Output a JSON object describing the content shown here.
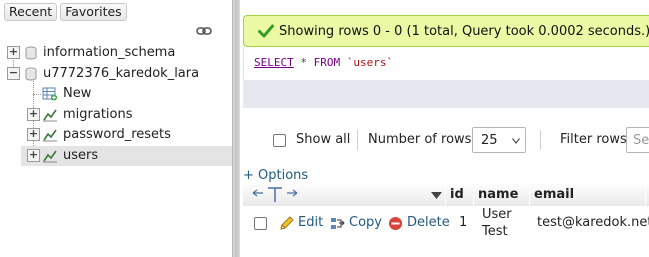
{
  "nav": {
    "tabs": [
      "Recent",
      "Favorites"
    ],
    "tree": {
      "databases": [
        {
          "name": "information_schema"
        },
        {
          "name": "u7772376_karedok_lara"
        }
      ],
      "new_label": "New",
      "tables": [
        "migrations",
        "password_resets",
        "users"
      ]
    }
  },
  "message": {
    "text": "Showing rows 0 - 0 (1 total, Query took 0.0002 seconds.)"
  },
  "sql": {
    "select": "SELECT",
    "star": "*",
    "from": "FROM",
    "table": "`users`"
  },
  "controls": {
    "show_all": "Show all",
    "rows_label": "Number of rows:",
    "rows_value": "25",
    "filter_label": "Filter rows:",
    "filter_placeholder": "Se"
  },
  "options_link": "+ Options",
  "table": {
    "columns": [
      "id",
      "name",
      "email"
    ],
    "rows": [
      {
        "edit": "Edit",
        "copy": "Copy",
        "delete": "Delete",
        "id": "1",
        "name_line1": "User",
        "name_line2": "Test",
        "email": "test@karedok.net"
      }
    ]
  },
  "icons": {
    "check": "check-icon",
    "edit": "pencil-icon",
    "copy": "copy-icon",
    "delete": "delete-icon"
  },
  "colors": {
    "success_bg": "#ebf8a4",
    "success_border": "#a2d246",
    "link": "#235a81",
    "selected_row": "#e4e4e4"
  }
}
